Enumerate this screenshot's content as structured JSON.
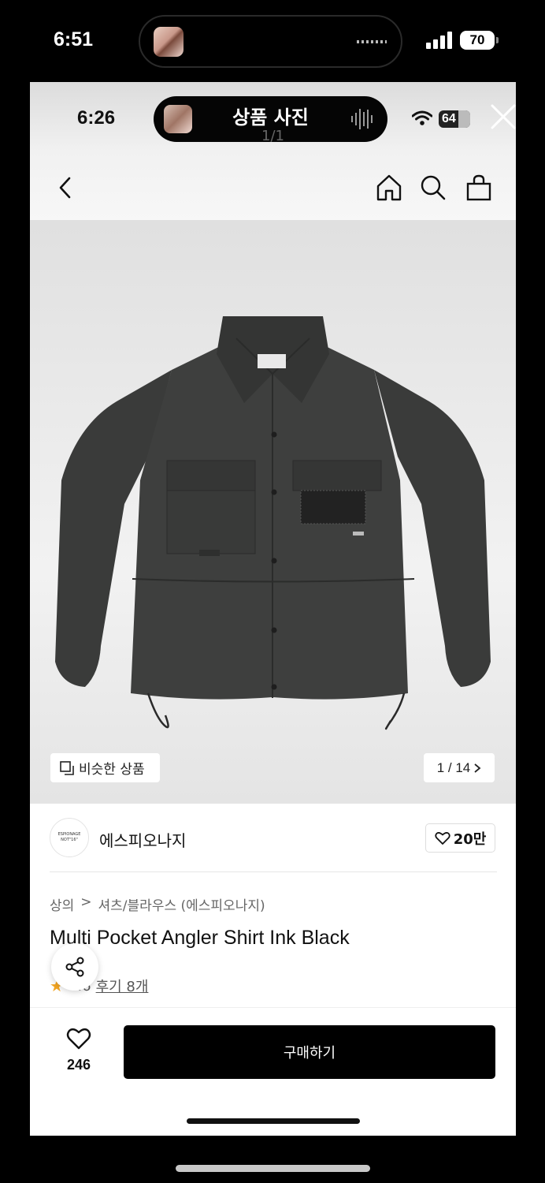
{
  "outer_status": {
    "time": "6:51",
    "battery": "70"
  },
  "inner_status": {
    "time": "6:26",
    "battery": "64"
  },
  "viewer": {
    "title": "상품 사진",
    "counter": "1/1"
  },
  "nav": {
    "back": "back-icon",
    "icons": [
      "home-icon",
      "search-icon",
      "bag-icon"
    ]
  },
  "gallery": {
    "similar_label": "비슷한 상품",
    "pager": "1 / 14"
  },
  "brand": {
    "logo_line1": "ESPIONAGE",
    "logo_line2": "NOT\"16\"",
    "name": "에스피오나지",
    "likes": "20만"
  },
  "breadcrumb": {
    "category": "상의",
    "separator": ">",
    "subcategory": "셔츠/블라우스 (에스피오나지)"
  },
  "product": {
    "name": "Multi Pocket Angler Shirt Ink Black",
    "rating": "4.6",
    "reviews": "후기 8개"
  },
  "bottom": {
    "wish_count": "246",
    "buy_label": "구매하기"
  },
  "colors": {
    "jacket": "#3a3b3a",
    "button": "#000000",
    "star": "#f4a623"
  }
}
